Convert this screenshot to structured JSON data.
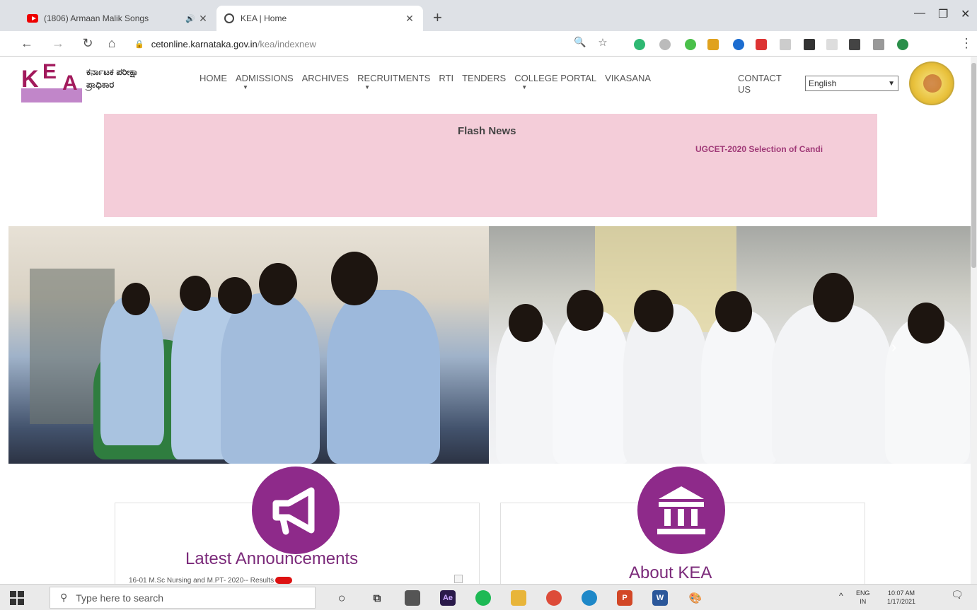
{
  "browser": {
    "tabs": [
      {
        "title": "(1806) Armaan Malik Songs",
        "icon": "youtube-icon",
        "active": false
      },
      {
        "title": "KEA | Home",
        "icon": "globe-icon",
        "active": true
      }
    ],
    "new_tab": "+",
    "url_host": "cetonline.karnataka.gov.in",
    "url_path": "/kea/indexnew"
  },
  "site": {
    "logo_letters": {
      "k": "K",
      "e": "E",
      "a": "A"
    },
    "org_name_line1": "ಕರ್ನಾಟಕ ಪರೀಕ್ಷಾ",
    "org_name_line2": "ಪ್ರಾಧಿಕಾರ",
    "nav": [
      {
        "label": "HOME",
        "caret": false
      },
      {
        "label": "ADMISSIONS",
        "caret": true
      },
      {
        "label": "ARCHIVES",
        "caret": false
      },
      {
        "label": "RECRUITMENTS",
        "caret": true
      },
      {
        "label": "RTI",
        "caret": false
      },
      {
        "label": "TENDERS",
        "caret": false
      },
      {
        "label": "COLLEGE PORTAL",
        "caret": true
      },
      {
        "label": "VIKASANA",
        "caret": false
      }
    ],
    "contact_line1": "CONTACT",
    "contact_line2": "US",
    "language": "English"
  },
  "flash_news": {
    "title": "Flash News",
    "ticker": "UGCET-2020 Selection of Candi"
  },
  "cards": {
    "announcements_title": "Latest Announcements",
    "announcement_item": "16-01 M.Sc Nursing and M.PT- 2020-- Results",
    "about_title": "About KEA"
  },
  "taskbar": {
    "search_placeholder": "Type here to search",
    "lang_line1": "ENG",
    "lang_line2": "IN",
    "time": "10:07 AM",
    "date": "1/17/2021"
  },
  "colors": {
    "brand_purple": "#8e2a8a",
    "flash_bg": "#f4cdd9",
    "logo_maroon": "#a21a5c"
  }
}
